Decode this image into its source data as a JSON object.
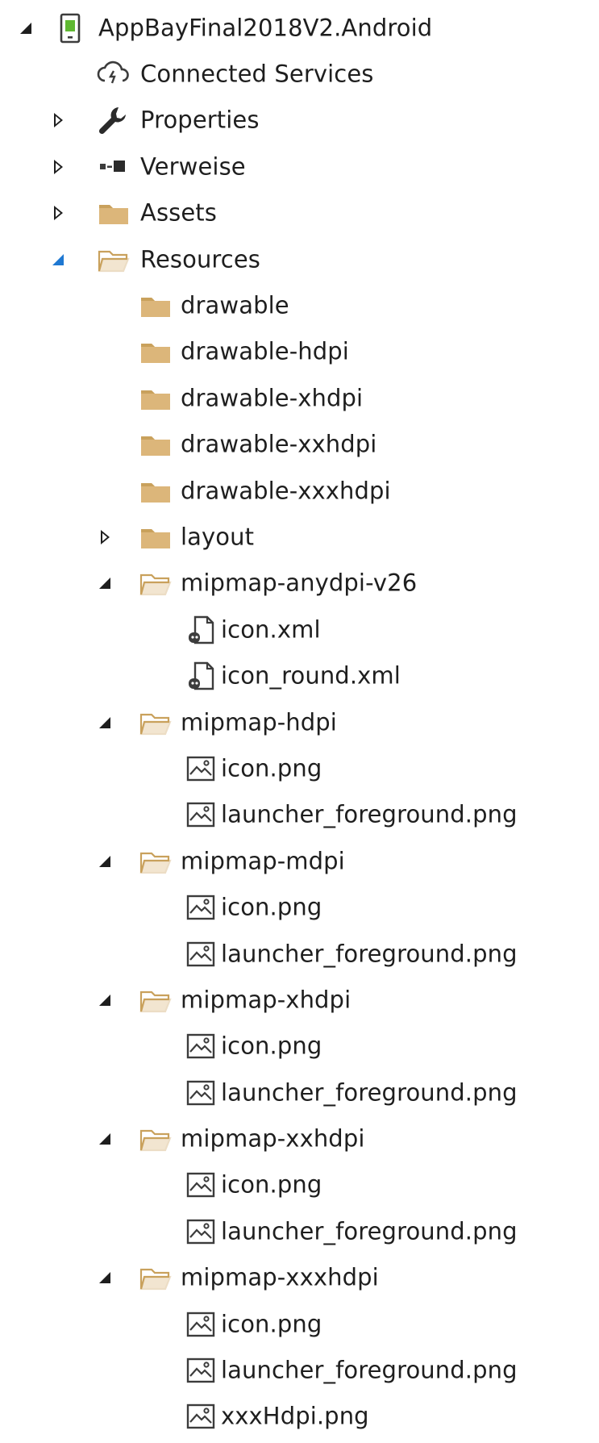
{
  "colors": {
    "folder": "#dcb67a",
    "folder_dark": "#c9a15c",
    "text": "#1e1e1e",
    "selected_arrow": "#1e78d2",
    "android_green": "#5fb832"
  },
  "tree": [
    {
      "label": "AppBayFinal2018V2.Android",
      "icon": "android-project-icon",
      "arrow": "expanded",
      "level": 0
    },
    {
      "label": "Connected Services",
      "icon": "connected-services-icon",
      "arrow": "none",
      "level": 1
    },
    {
      "label": "Properties",
      "icon": "wrench-icon",
      "arrow": "collapsed",
      "level": 1
    },
    {
      "label": "Verweise",
      "icon": "references-icon",
      "arrow": "collapsed",
      "level": 1
    },
    {
      "label": "Assets",
      "icon": "folder-icon",
      "arrow": "collapsed",
      "level": 1
    },
    {
      "label": "Resources",
      "icon": "folder-open-icon",
      "arrow": "expanded-blue",
      "level": 1
    },
    {
      "label": "drawable",
      "icon": "folder-icon",
      "arrow": "none",
      "level": 2
    },
    {
      "label": "drawable-hdpi",
      "icon": "folder-icon",
      "arrow": "none",
      "level": 2
    },
    {
      "label": "drawable-xhdpi",
      "icon": "folder-icon",
      "arrow": "none",
      "level": 2
    },
    {
      "label": "drawable-xxhdpi",
      "icon": "folder-icon",
      "arrow": "none",
      "level": 2
    },
    {
      "label": "drawable-xxxhdpi",
      "icon": "folder-icon",
      "arrow": "none",
      "level": 2
    },
    {
      "label": "layout",
      "icon": "folder-icon",
      "arrow": "collapsed",
      "level": 2
    },
    {
      "label": "mipmap-anydpi-v26",
      "icon": "folder-open-icon",
      "arrow": "expanded",
      "level": 2
    },
    {
      "label": "icon.xml",
      "icon": "xml-file-icon",
      "arrow": "none",
      "level": 3
    },
    {
      "label": "icon_round.xml",
      "icon": "xml-file-icon",
      "arrow": "none",
      "level": 3
    },
    {
      "label": "mipmap-hdpi",
      "icon": "folder-open-icon",
      "arrow": "expanded",
      "level": 2
    },
    {
      "label": "icon.png",
      "icon": "image-file-icon",
      "arrow": "none",
      "level": 3
    },
    {
      "label": "launcher_foreground.png",
      "icon": "image-file-icon",
      "arrow": "none",
      "level": 3
    },
    {
      "label": "mipmap-mdpi",
      "icon": "folder-open-icon",
      "arrow": "expanded",
      "level": 2
    },
    {
      "label": "icon.png",
      "icon": "image-file-icon",
      "arrow": "none",
      "level": 3
    },
    {
      "label": "launcher_foreground.png",
      "icon": "image-file-icon",
      "arrow": "none",
      "level": 3
    },
    {
      "label": "mipmap-xhdpi",
      "icon": "folder-open-icon",
      "arrow": "expanded",
      "level": 2
    },
    {
      "label": "icon.png",
      "icon": "image-file-icon",
      "arrow": "none",
      "level": 3
    },
    {
      "label": "launcher_foreground.png",
      "icon": "image-file-icon",
      "arrow": "none",
      "level": 3
    },
    {
      "label": "mipmap-xxhdpi",
      "icon": "folder-open-icon",
      "arrow": "expanded",
      "level": 2
    },
    {
      "label": "icon.png",
      "icon": "image-file-icon",
      "arrow": "none",
      "level": 3
    },
    {
      "label": "launcher_foreground.png",
      "icon": "image-file-icon",
      "arrow": "none",
      "level": 3
    },
    {
      "label": "mipmap-xxxhdpi",
      "icon": "folder-open-icon",
      "arrow": "expanded",
      "level": 2
    },
    {
      "label": "icon.png",
      "icon": "image-file-icon",
      "arrow": "none",
      "level": 3
    },
    {
      "label": "launcher_foreground.png",
      "icon": "image-file-icon",
      "arrow": "none",
      "level": 3
    },
    {
      "label": "xxxHdpi.png",
      "icon": "image-file-icon",
      "arrow": "none",
      "level": 3
    }
  ]
}
